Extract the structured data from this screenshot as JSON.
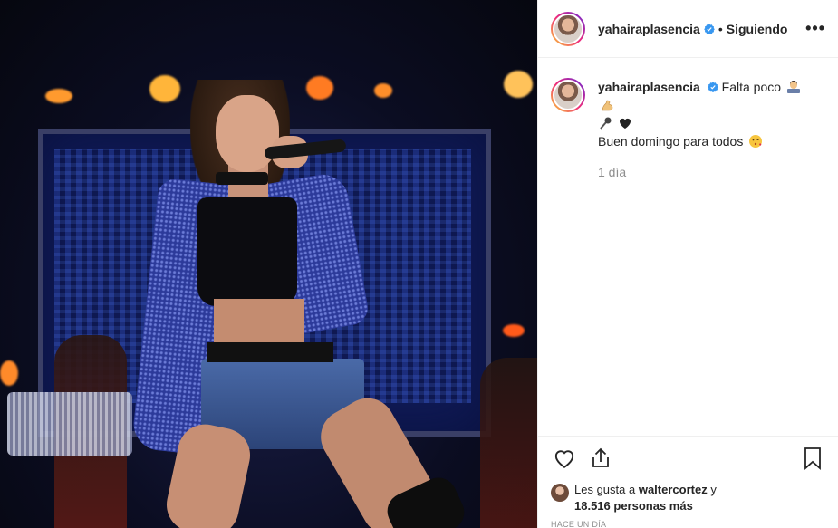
{
  "post": {
    "author": {
      "username": "yahairaplasencia",
      "verified": true,
      "follow_separator": "•",
      "follow_status": "Siguiendo"
    },
    "more_label": "•••",
    "caption": {
      "line1": "Falta poco",
      "line3": "Buen domingo para todos",
      "emojis": [
        "woman-technologist-emoji",
        "flexed-biceps-emoji",
        "microphone-emoji",
        "black-heart-emoji",
        "face-blowing-kiss-emoji"
      ]
    },
    "relative_time": "1 día",
    "likes": {
      "prefix": "Les gusta a",
      "user": "waltercortez",
      "joiner": "y",
      "count_text": "18.516 personas más"
    },
    "timestamp": "HACE UN DÍA"
  },
  "colors": {
    "verified_blue": "#3897f0",
    "muted_text": "#8e8e8e",
    "border": "#efefef"
  }
}
